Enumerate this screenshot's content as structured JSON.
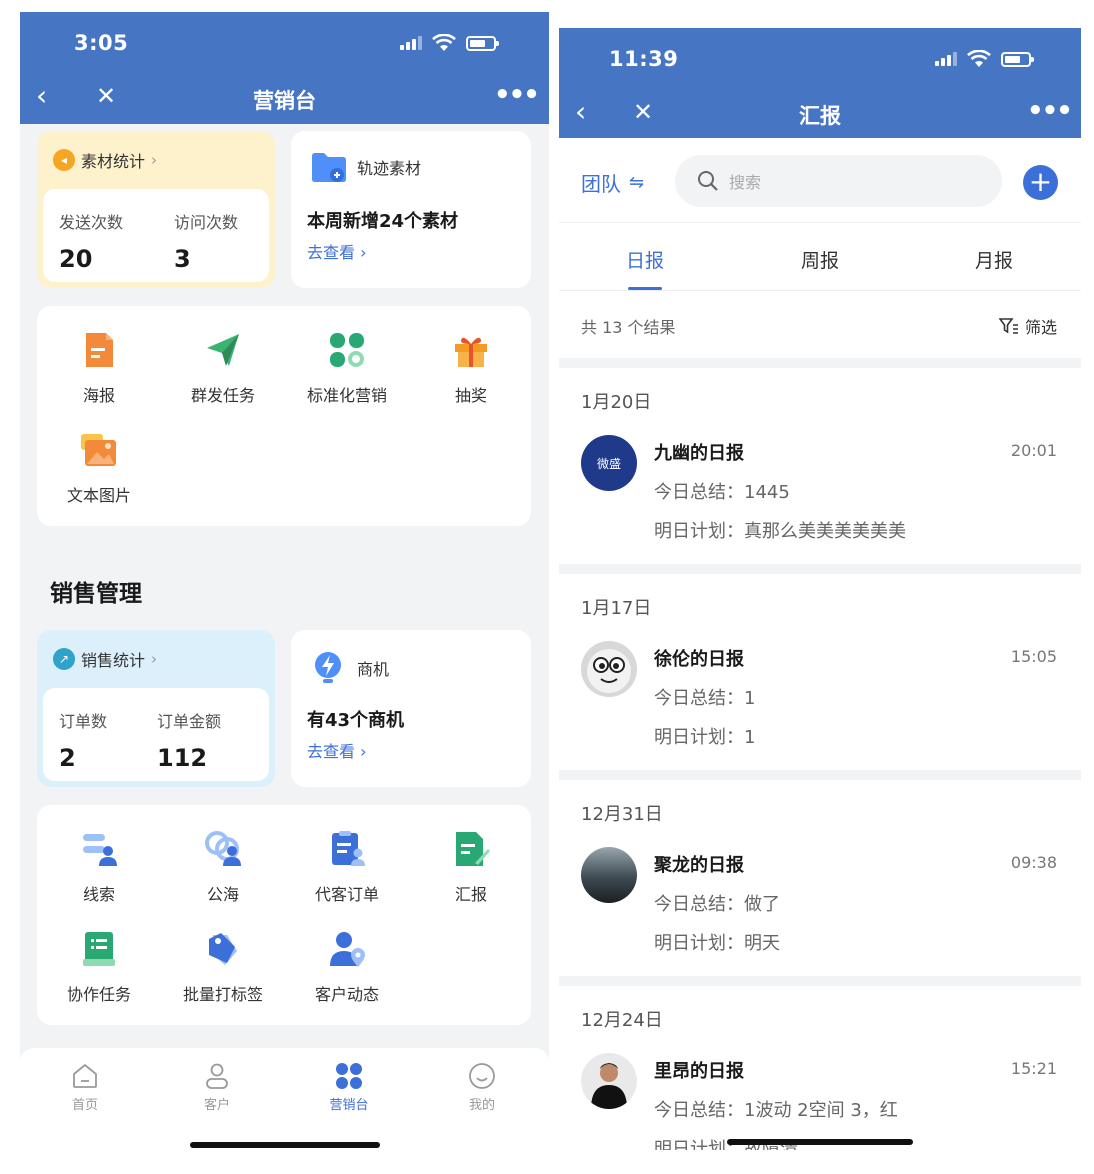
{
  "left": {
    "status": {
      "time": "3:05"
    },
    "nav": {
      "back": "‹",
      "close": "✕",
      "title": "营销台",
      "more": "•••"
    },
    "material_stats": {
      "title": "素材统计",
      "cols": [
        {
          "label": "发送次数",
          "value": "20"
        },
        {
          "label": "访问次数",
          "value": "3"
        }
      ]
    },
    "track_material": {
      "title": "轨迹素材",
      "main": "本周新增24个素材",
      "link": "去查看"
    },
    "marketing_grid": [
      "海报",
      "群发任务",
      "标准化营销",
      "抽奖",
      "文本图片"
    ],
    "sales_section_title": "销售管理",
    "sales_stats": {
      "title": "销售统计",
      "cols": [
        {
          "label": "订单数",
          "value": "2"
        },
        {
          "label": "订单金额",
          "value": "112"
        }
      ]
    },
    "opportunity": {
      "title": "商机",
      "main": "有43个商机",
      "link": "去查看"
    },
    "sales_grid": [
      "线索",
      "公海",
      "代客订单",
      "汇报",
      "协作任务",
      "批量打标签",
      "客户动态"
    ],
    "tabbar": [
      "首页",
      "客户",
      "营销台",
      "我的"
    ],
    "colors": {
      "header": "#4675c4",
      "accent": "#3d6fd9"
    }
  },
  "right": {
    "status": {
      "time": "11:39"
    },
    "nav": {
      "back": "‹",
      "close": "✕",
      "title": "汇报",
      "more": "•••"
    },
    "team": "团队",
    "search_placeholder": "搜索",
    "tabs": [
      "日报",
      "周报",
      "月报"
    ],
    "count": "共 13 个结果",
    "filter": "筛选",
    "groups": [
      {
        "date": "1月20日",
        "name": "九幽的日报",
        "time": "20:01",
        "summary": "今日总结：1445",
        "plan": "明日计划：真那么美美美美美美",
        "avatar_text": "微盛"
      },
      {
        "date": "1月17日",
        "name": "徐伦的日报",
        "time": "15:05",
        "summary": "今日总结：1",
        "plan": "明日计划：1"
      },
      {
        "date": "12月31日",
        "name": "聚龙的日报",
        "time": "09:38",
        "summary": "今日总结：做了",
        "plan": "明日计划：明天"
      },
      {
        "date": "12月24日",
        "name": "里昂的日报",
        "time": "15:21",
        "summary": "今日总结：1波动 2空间 3，红",
        "plan": "明日计划：故障清"
      }
    ]
  }
}
